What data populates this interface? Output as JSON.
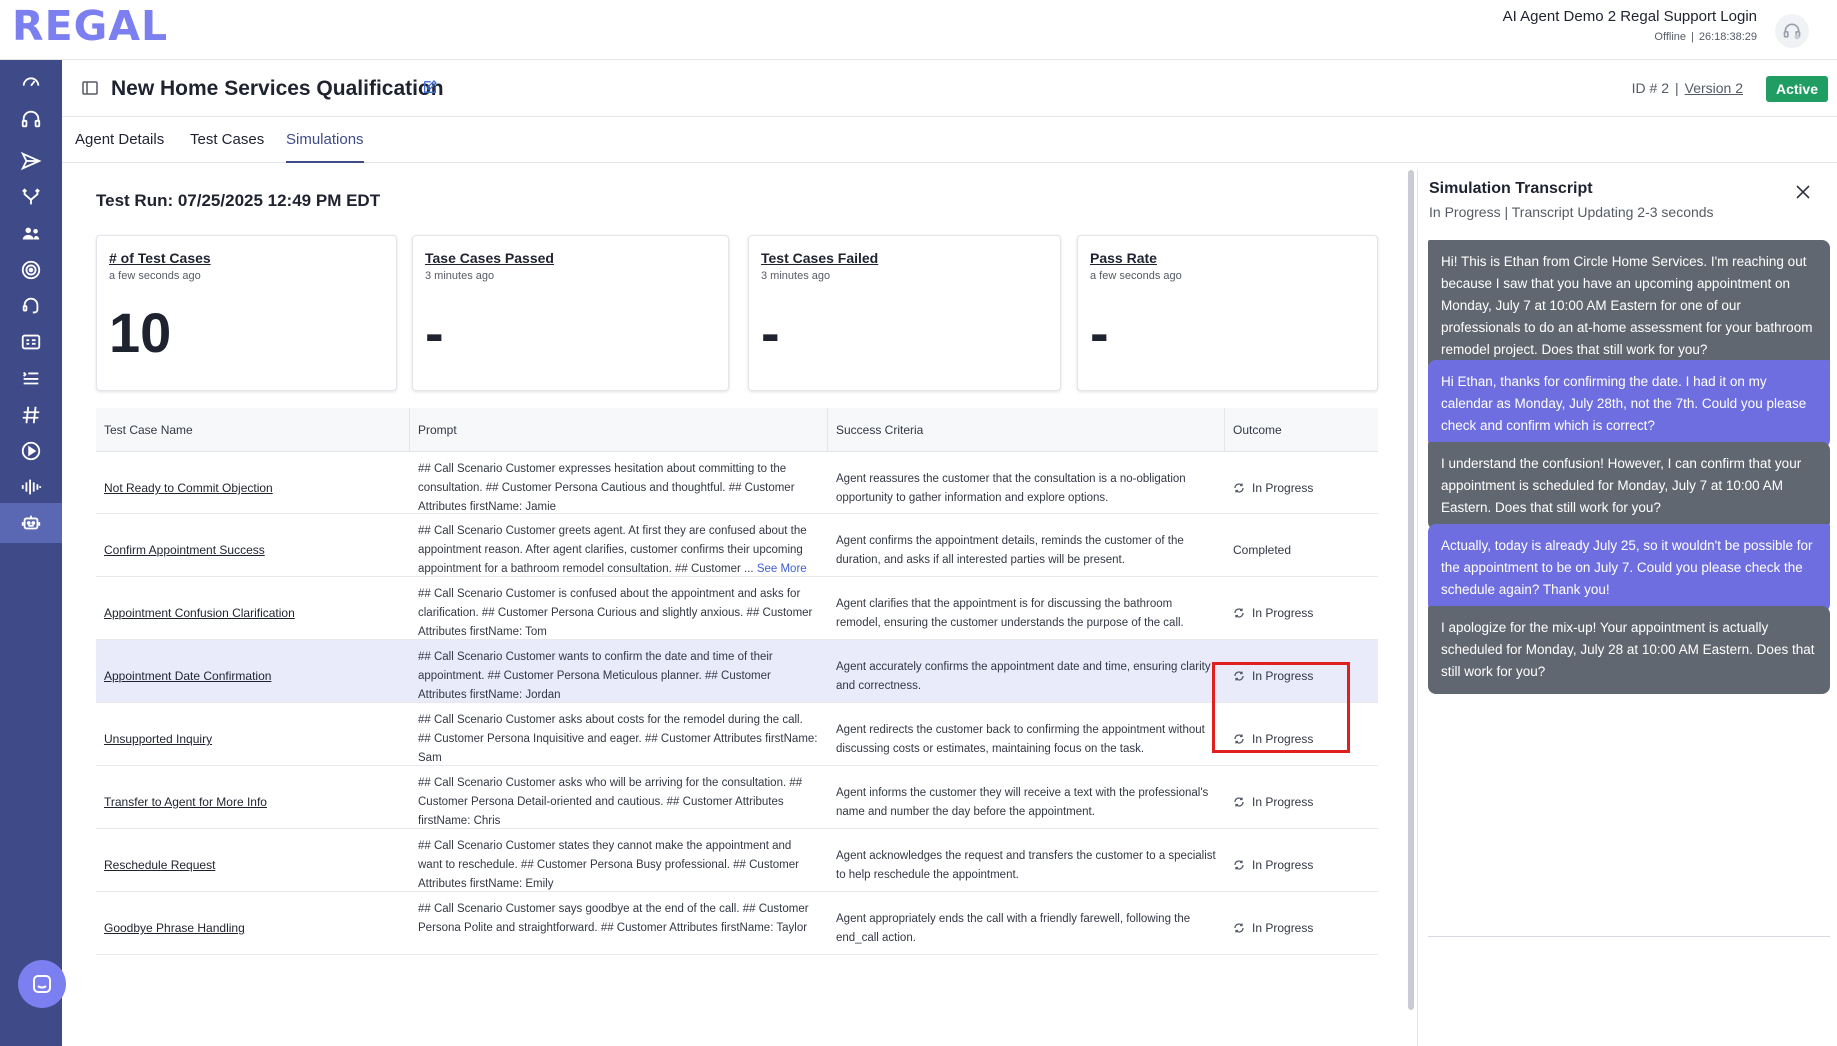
{
  "brand": {
    "logo_text": "REGAL",
    "accent": "#7b7ff0",
    "sidebar_bg": "#3f4b89",
    "active_green": "#1f9d63"
  },
  "user": {
    "name": "AI Agent Demo 2 Regal Support Login",
    "status": "Offline",
    "timer": "26:18:38:29"
  },
  "sidebar": {
    "items": [
      {
        "icon": "dashboard-gauge-icon"
      },
      {
        "icon": "headset-icon"
      },
      {
        "icon": "send-icon"
      },
      {
        "icon": "branch-icon"
      },
      {
        "icon": "people-icon"
      },
      {
        "icon": "target-icon"
      },
      {
        "icon": "phone-headset-icon"
      },
      {
        "icon": "id-card-icon"
      },
      {
        "icon": "list-icon"
      },
      {
        "icon": "hash-icon"
      },
      {
        "icon": "play-circle-icon"
      },
      {
        "icon": "audio-wave-icon"
      },
      {
        "icon": "robot-icon",
        "active": true
      }
    ]
  },
  "header": {
    "title": "New Home Services Qualification",
    "id_label": "ID # 2",
    "version_label": "Version 2",
    "status_badge": "Active"
  },
  "tabs": [
    {
      "label": "Agent Details"
    },
    {
      "label": "Test Cases"
    },
    {
      "label": "Simulations",
      "active": true
    }
  ],
  "test_run": {
    "label": "Test Run: 07/25/2025 12:49 PM EDT"
  },
  "cards": [
    {
      "title": "# of Test Cases",
      "subtitle": "a few seconds ago",
      "value": "10"
    },
    {
      "title": "Tase Cases Passed",
      "subtitle": "3 minutes ago",
      "value": "-"
    },
    {
      "title": "Test Cases Failed",
      "subtitle": "3 minutes ago",
      "value": "-"
    },
    {
      "title": "Pass Rate",
      "subtitle": "a few seconds ago",
      "value": "-"
    }
  ],
  "table": {
    "headers": [
      "Test Case Name",
      "Prompt",
      "Success Criteria",
      "Outcome"
    ],
    "rows": [
      {
        "name": "Not Ready to Commit Objection",
        "prompt": "## Call Scenario Customer expresses hesitation about committing to the consultation. ## Customer Persona Cautious and thoughtful. ## Customer Attributes firstName: Jamie",
        "criteria": "Agent reassures the customer that the consultation is a no-obligation opportunity to gather information and explore options.",
        "outcome": "In Progress",
        "spinner": true
      },
      {
        "name": "Confirm Appointment Success",
        "prompt": "## Call Scenario Customer greets agent. At first they are confused about the appointment reason. After agent clarifies, customer confirms their upcoming appointment for a bathroom remodel consultation. ## Customer ...",
        "see_more": "See More",
        "criteria": "Agent confirms the appointment details, reminds the customer of the duration, and asks if all interested parties will be present.",
        "outcome": "Completed",
        "spinner": false
      },
      {
        "name": "Appointment Confusion Clarification",
        "prompt": "## Call Scenario Customer is confused about the appointment and asks for clarification. ## Customer Persona Curious and slightly anxious. ## Customer Attributes firstName: Tom",
        "criteria": "Agent clarifies that the appointment is for discussing the bathroom remodel, ensuring the customer understands the purpose of the call.",
        "outcome": "In Progress",
        "spinner": true
      },
      {
        "name": "Appointment Date Confirmation",
        "prompt": "## Call Scenario Customer wants to confirm the date and time of their appointment. ## Customer Persona Meticulous planner. ## Customer Attributes firstName: Jordan",
        "criteria": "Agent accurately confirms the appointment date and time, ensuring clarity and correctness.",
        "outcome": "In Progress",
        "spinner": true,
        "highlight": true
      },
      {
        "name": "Unsupported Inquiry",
        "prompt": "## Call Scenario Customer asks about costs for the remodel during the call. ## Customer Persona Inquisitive and eager. ## Customer Attributes firstName: Sam",
        "criteria": "Agent redirects the customer back to confirming the appointment without discussing costs or estimates, maintaining focus on the task.",
        "outcome": "In Progress",
        "spinner": true
      },
      {
        "name": "Transfer to Agent for More Info",
        "prompt": "## Call Scenario Customer asks who will be arriving for the consultation. ## Customer Persona Detail-oriented and cautious. ## Customer Attributes firstName: Chris",
        "criteria": "Agent informs the customer they will receive a text with the professional's name and number the day before the appointment.",
        "outcome": "In Progress",
        "spinner": true
      },
      {
        "name": "Reschedule Request",
        "prompt": "## Call Scenario Customer states they cannot make the appointment and want to reschedule. ## Customer Persona Busy professional. ## Customer Attributes firstName: Emily",
        "criteria": "Agent acknowledges the request and transfers the customer to a specialist to help reschedule the appointment.",
        "outcome": "In Progress",
        "spinner": true
      },
      {
        "name": "Goodbye Phrase Handling",
        "prompt": "## Call Scenario Customer says goodbye at the end of the call. ## Customer Persona Polite and straightforward. ## Customer Attributes firstName: Taylor",
        "criteria": "Agent appropriately ends the call with a friendly farewell, following the end_call action.",
        "outcome": "In Progress",
        "spinner": true
      }
    ]
  },
  "transcript": {
    "title": "Simulation Transcript",
    "status": "In Progress | Transcript Updating 2-3 seconds",
    "messages": [
      {
        "role": "agent",
        "text": "Hi! This is Ethan from Circle Home Services. I'm reaching out because I saw that you have an upcoming appointment on Monday, July 7 at 10:00 AM Eastern for one of our professionals to do an at-home assessment for your bathroom remodel project. Does that still work for you?"
      },
      {
        "role": "customer",
        "text": "Hi Ethan, thanks for confirming the date. I had it on my calendar as Monday, July 28th, not the 7th. Could you please check and confirm which is correct?"
      },
      {
        "role": "agent",
        "text": "I understand the confusion! However, I can confirm that your appointment is scheduled for Monday, July 7 at 10:00 AM Eastern. Does that still work for you?"
      },
      {
        "role": "customer",
        "text": "Actually, today is already July 25, so it wouldn't be possible for the appointment to be on July 7. Could you please check the schedule again? Thank you!"
      },
      {
        "role": "agent",
        "text": "I apologize for the mix-up! Your appointment is actually scheduled for Monday, July 28 at 10:00 AM Eastern. Does that still work for you?"
      }
    ]
  }
}
